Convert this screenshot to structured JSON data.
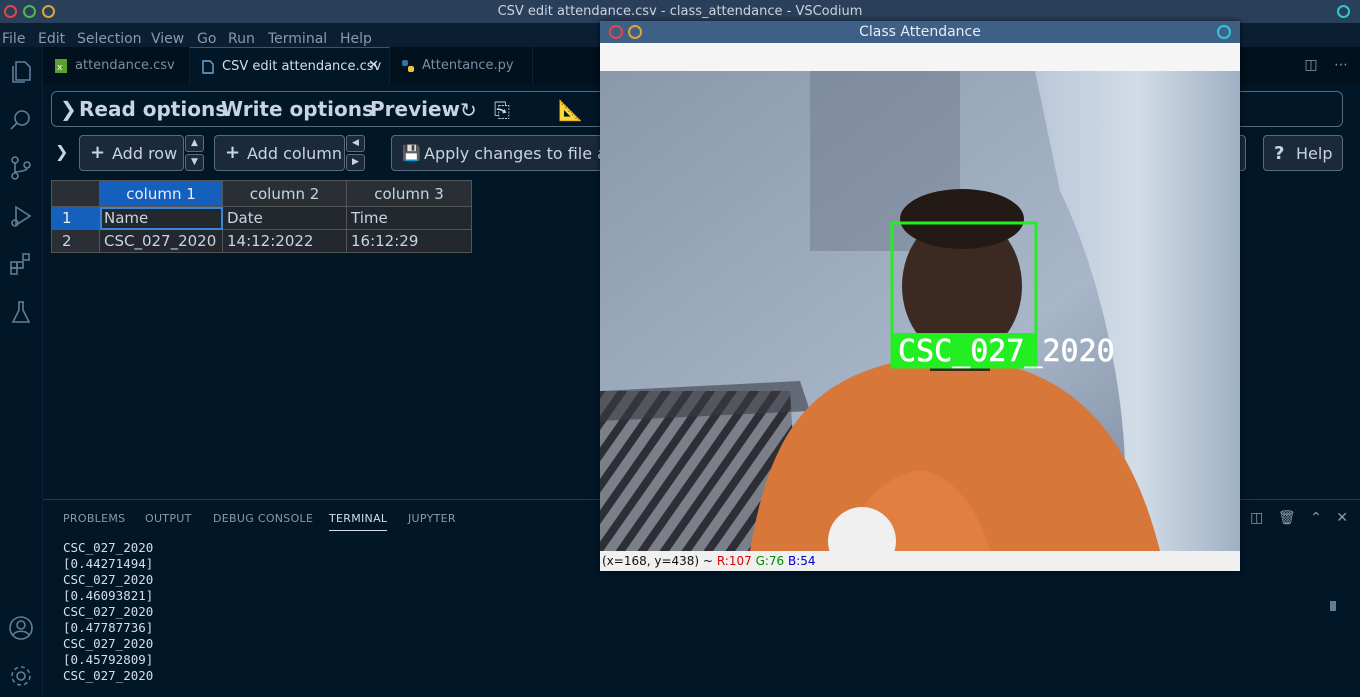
{
  "window": {
    "title": "CSV edit attendance.csv - class_attendance - VSCodium"
  },
  "menu": [
    "File",
    "Edit",
    "Selection",
    "View",
    "Go",
    "Run",
    "Terminal",
    "Help"
  ],
  "tabs": [
    {
      "label": "attendance.csv",
      "icon": "csv-file-icon",
      "active": false
    },
    {
      "label": "CSV edit attendance.csv",
      "icon": "preview-file-icon",
      "active": true
    },
    {
      "label": "Attentance.py",
      "icon": "python-file-icon",
      "active": false
    }
  ],
  "csv": {
    "read_options": "Read options",
    "write_options": "Write options",
    "preview": "Preview",
    "add_row": "Add row",
    "add_column": "Add column",
    "apply": "Apply changes to file and",
    "help": "Help",
    "columns": [
      "column 1",
      "column 2",
      "column 3"
    ],
    "rows": [
      {
        "index": "1",
        "cells": [
          "Name",
          "Date",
          "Time"
        ]
      },
      {
        "index": "2",
        "cells": [
          "CSC_027_2020",
          "14:12:2022",
          "16:12:29"
        ]
      }
    ]
  },
  "panel": {
    "tabs": [
      "PROBLEMS",
      "OUTPUT",
      "DEBUG CONSOLE",
      "TERMINAL",
      "JUPYTER"
    ],
    "active_tab": "TERMINAL",
    "terminal_lines": [
      "CSC_027_2020",
      "[0.44271494]",
      "CSC_027_2020",
      "[0.46093821]",
      "CSC_027_2020",
      "[0.47787736]",
      "CSC_027_2020",
      "[0.45792809]",
      "CSC_027_2020"
    ]
  },
  "cv_window": {
    "title": "Class Attendance",
    "face_label": "CSC_027_2020",
    "status_coords": "(x=168, y=438) ~",
    "status_r": "R:107",
    "status_g": "G:76",
    "status_b": "B:54"
  },
  "colors": {
    "editor_bg": "#011627",
    "accent": "#1560bd",
    "detection_box": "#22ee22"
  }
}
